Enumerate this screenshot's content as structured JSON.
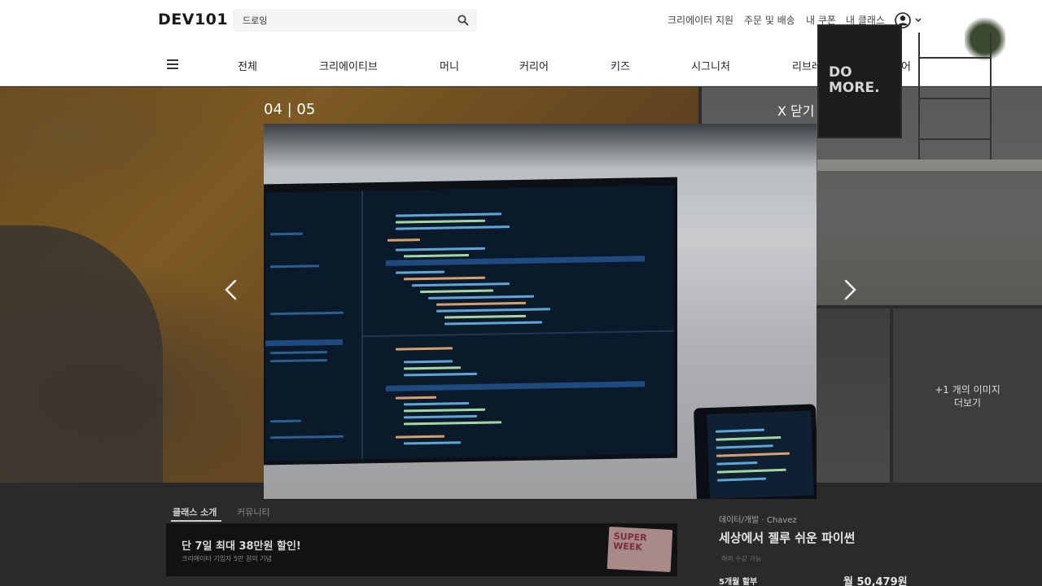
{
  "header": {
    "logo": "DEV101",
    "search": {
      "value": "드로잉",
      "placeholder": ""
    },
    "links": [
      "크리에이터 지원",
      "주문 및 배송",
      "내 쿠폰",
      "내 클래스"
    ]
  },
  "nav": {
    "items": [
      "전체",
      "크리에이티브",
      "머니",
      "커리어",
      "키즈",
      "시그니처",
      "리브레",
      "스토어"
    ]
  },
  "lightbox": {
    "counter": "04 | 05",
    "close_label": "X 닫기",
    "more_images": [
      "+1 개의 이미지",
      "더보기"
    ]
  },
  "thumbnail": {
    "monitor_text_1": "DO",
    "monitor_text_2": "MORE."
  },
  "tabs": [
    "클래스 소개",
    "커뮤니티"
  ],
  "banner": {
    "title": "단 7일 최대 38만원 할인!",
    "subtitle": "크리에이터 기입자 5만 원의 기념",
    "sticker_1": "SUPER",
    "sticker_2": "WEEK"
  },
  "sidebar": {
    "category": "데이터/개발 · Chavez",
    "title": "세상에서 젤루 쉬운 파이썬",
    "note": "해외 수강 가능",
    "plan": "5개월 할부",
    "price": "월 50,479원"
  },
  "colors": {
    "accent_highlight": "#1f4a80",
    "screen_bg": "#0b1a2b"
  }
}
